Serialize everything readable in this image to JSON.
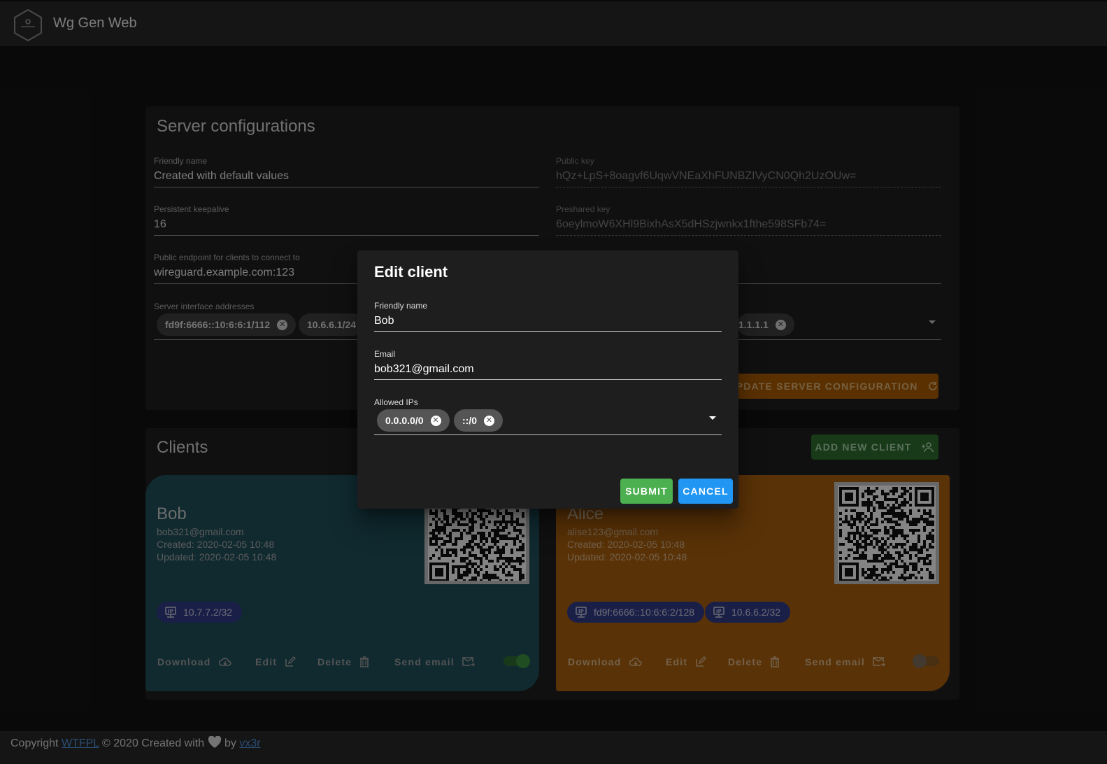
{
  "app": {
    "title": "Wg Gen Web"
  },
  "server": {
    "title": "Server configurations",
    "friendly_name": {
      "label": "Friendly name",
      "value": "Created with default values"
    },
    "public_key": {
      "label": "Public key",
      "value": "hQz+LpS+8oagvf6UqwVNEaXhFUNBZIVyCN0Qh2UzOUw="
    },
    "persistent_keepalive": {
      "label": "Persistent keepalive",
      "value": "16"
    },
    "preshared_key": {
      "label": "Preshared key",
      "value": "6oeylmoW6XHl9BixhAsX5dHSzjwnkx1fthe598SFb74="
    },
    "endpoint": {
      "label": "Public endpoint for clients to connect to",
      "value": "wireguard.example.com:123"
    },
    "interface_addresses": {
      "label": "Server interface addresses",
      "chips": [
        "fd9f:6666::10:6:6:1/112",
        "10.6.6.1/24"
      ]
    },
    "dns_chips": [
      "1.1.1.1"
    ],
    "update_label": "Update server configuration"
  },
  "clients": {
    "title": "Clients",
    "add_label": "Add new client",
    "cards": [
      {
        "name": "Bob",
        "email": "bob321@gmail.com",
        "created": "Created: 2020-02-05 10:48",
        "updated": "Updated: 2020-02-05 10:48",
        "ips": [
          "10.7.7.2/32"
        ],
        "enabled": true,
        "color": "#1e4e59"
      },
      {
        "name": "Alice",
        "email": "alise123@gmail.com",
        "created": "Created: 2020-02-05 10:48",
        "updated": "Updated: 2020-02-05 10:48",
        "ips": [
          "fd9f:6666::10:6:6:2/128",
          "10.6.6.2/32"
        ],
        "enabled": false,
        "color": "#a65d0d"
      }
    ],
    "actions": {
      "download": "Download",
      "edit": "Edit",
      "delete": "Delete",
      "send_email": "Send email"
    }
  },
  "dialog": {
    "title": "Edit client",
    "friendly_name": {
      "label": "Friendly name",
      "value": "Bob"
    },
    "email": {
      "label": "Email",
      "value": "bob321@gmail.com"
    },
    "allowed_ips": {
      "label": "Allowed IPs",
      "chips": [
        "0.0.0.0/0",
        "::/0"
      ]
    },
    "submit_label": "Submit",
    "cancel_label": "Cancel"
  },
  "footer": {
    "copyright": "Copyright",
    "license_link": "WTFPL",
    "created_text": "© 2020 Created with",
    "by_text": "by",
    "author_link": "vx3r"
  },
  "icons": {
    "logo": "wg-gen-web-logo",
    "chip_close": "close-circle-icon",
    "ip": "ip-network-icon",
    "download": "cloud-download-icon",
    "edit": "pencil-box-icon",
    "delete": "trash-can-icon",
    "send_email": "email-send-icon",
    "update": "refresh-icon",
    "add": "account-multiple-plus-icon",
    "heart": "heart-icon"
  }
}
